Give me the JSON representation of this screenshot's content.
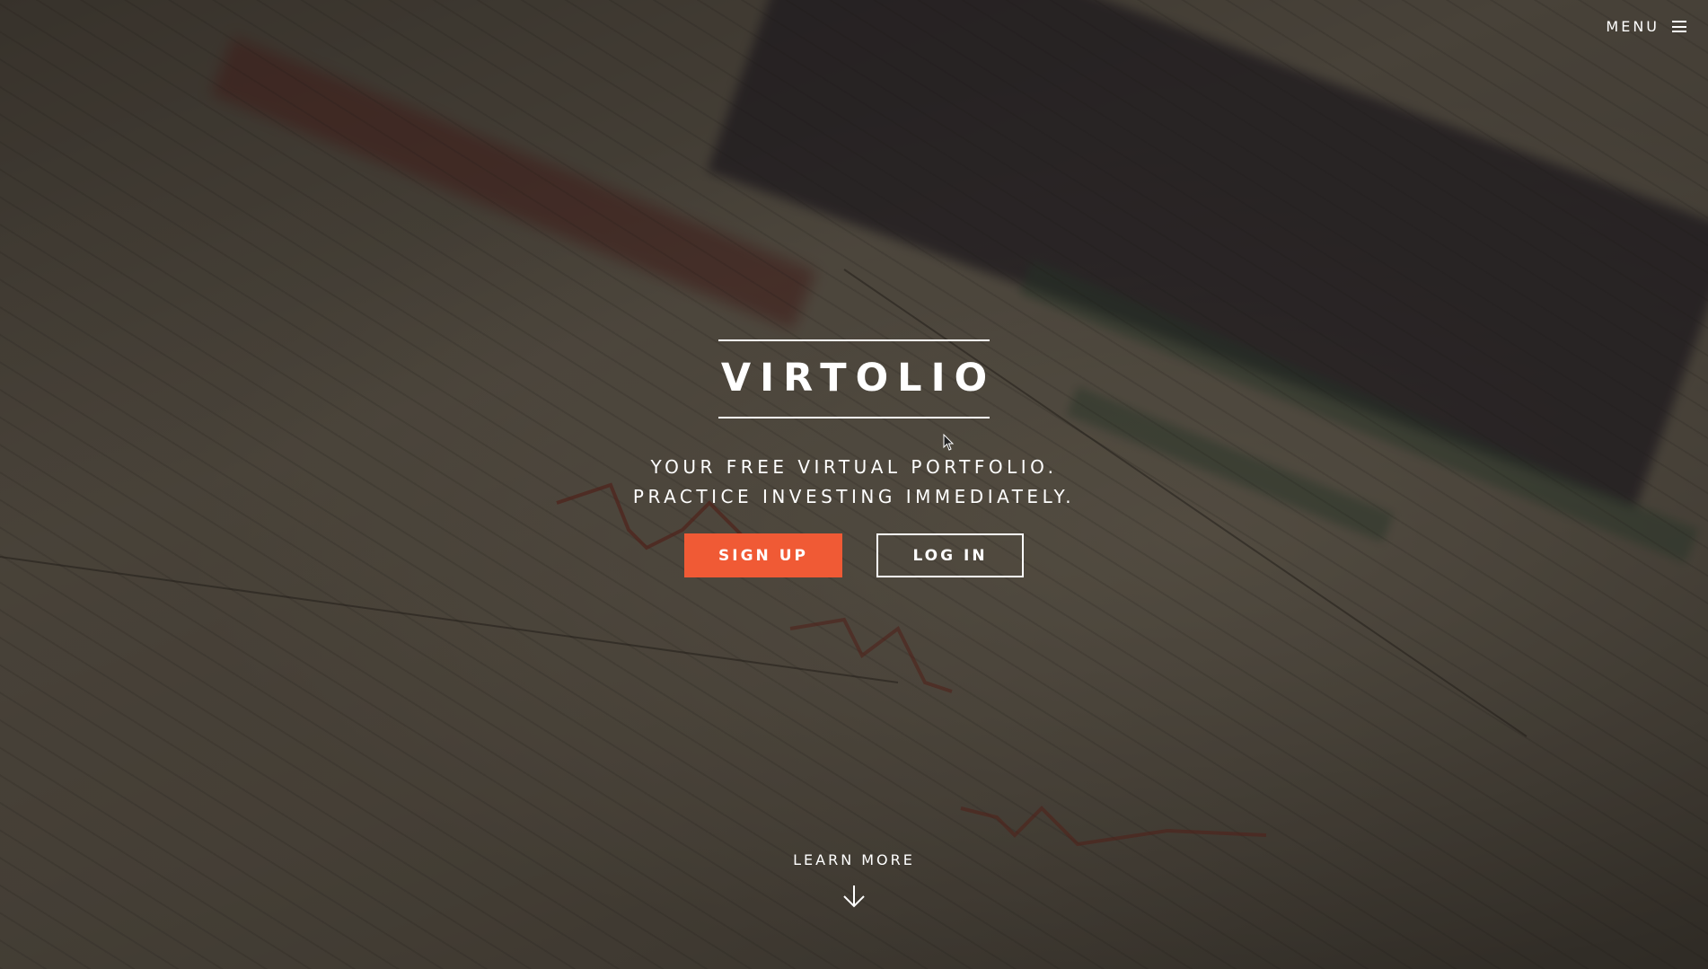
{
  "header": {
    "menu_label": "MENU",
    "menu_icon": "hamburger-icon"
  },
  "hero": {
    "brand": "VIRTOLIO",
    "tagline_line1": "YOUR FREE VIRTUAL PORTFOLIO.",
    "tagline_line2": "PRACTICE INVESTING IMMEDIATELY.",
    "signup_label": "SIGN UP",
    "login_label": "LOG IN",
    "learn_more_label": "LEARN MORE",
    "learn_more_icon": "arrow-down-icon"
  },
  "colors": {
    "accent": "#f05a35",
    "text": "#ffffff"
  }
}
